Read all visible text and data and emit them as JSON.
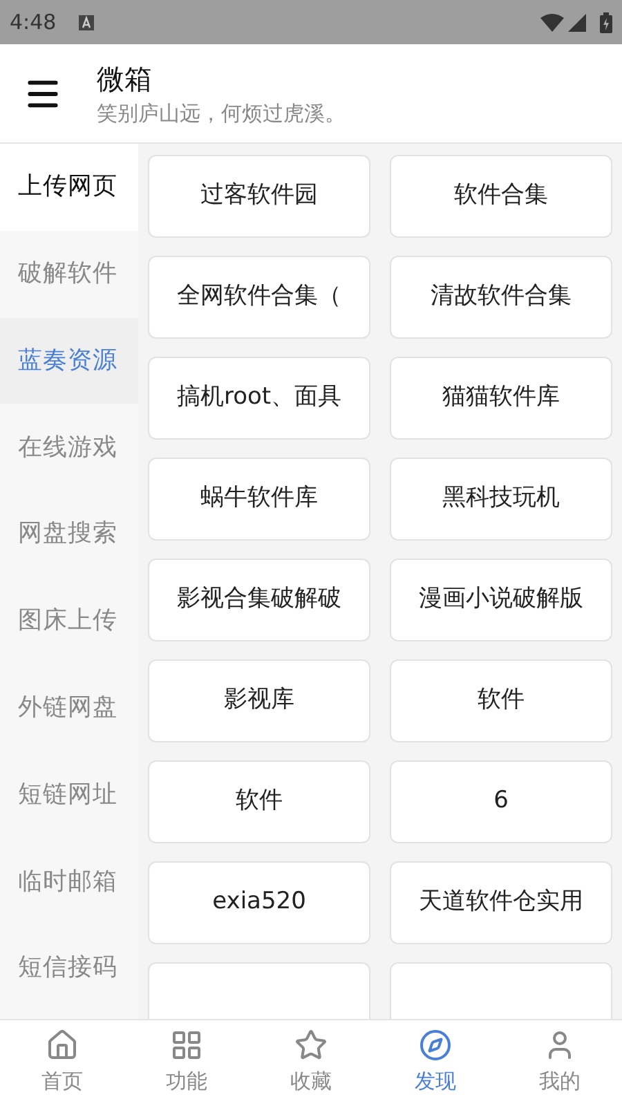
{
  "status_bar": {
    "time": "4:48"
  },
  "header": {
    "title": "微箱",
    "subtitle": "笑别庐山远，何烦过虎溪。"
  },
  "sidebar": {
    "items": [
      {
        "label": "上传网页",
        "kind": "heading",
        "selected": false
      },
      {
        "label": "破解软件",
        "kind": "link",
        "selected": false
      },
      {
        "label": "蓝奏资源",
        "kind": "link",
        "selected": true
      },
      {
        "label": "在线游戏",
        "kind": "link",
        "selected": false
      },
      {
        "label": "网盘搜索",
        "kind": "link",
        "selected": false
      },
      {
        "label": "图床上传",
        "kind": "link",
        "selected": false
      },
      {
        "label": "外链网盘",
        "kind": "link",
        "selected": false
      },
      {
        "label": "短链网址",
        "kind": "link",
        "selected": false
      },
      {
        "label": "临时邮箱",
        "kind": "link",
        "selected": false
      },
      {
        "label": "短信接码",
        "kind": "link",
        "selected": false
      }
    ]
  },
  "grid": {
    "cards": [
      {
        "kind": "text",
        "label": "过客软件园"
      },
      {
        "kind": "text",
        "label": "软件合集"
      },
      {
        "kind": "text",
        "label": "全网软件合集（"
      },
      {
        "kind": "text",
        "label": "清故软件合集"
      },
      {
        "kind": "text",
        "label": "搞机root、面具"
      },
      {
        "kind": "text",
        "label": "猫猫软件库"
      },
      {
        "kind": "text",
        "label": "蜗牛软件库"
      },
      {
        "kind": "text",
        "label": "黑科技玩机"
      },
      {
        "kind": "text",
        "label": "影视合集破解破"
      },
      {
        "kind": "text",
        "label": "漫画小说破解版"
      },
      {
        "kind": "text",
        "label": "影视库"
      },
      {
        "kind": "text",
        "label": "软件"
      },
      {
        "kind": "text",
        "label": "软件"
      },
      {
        "kind": "text",
        "label": "6"
      },
      {
        "kind": "text",
        "label": "exia520"
      },
      {
        "kind": "text",
        "label": "天道软件仓实用"
      },
      {
        "kind": "blank"
      },
      {
        "kind": "blank"
      }
    ]
  },
  "bottom_nav": {
    "items": [
      {
        "label": "首页",
        "selected": false
      },
      {
        "label": "功能",
        "selected": false
      },
      {
        "label": "收藏",
        "selected": false
      },
      {
        "label": "发现",
        "selected": true
      },
      {
        "label": "我的",
        "selected": false
      }
    ]
  }
}
